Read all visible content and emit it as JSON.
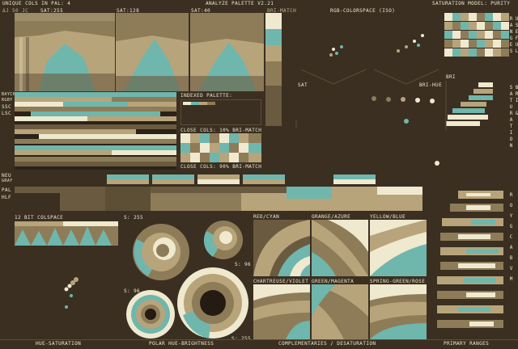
{
  "app": {
    "title": "ANALYZE PALETTE V2.21",
    "header_left": "UNIQUE COLS IN PAL: 4",
    "header_right": "SATURATION MODEL: PURITY",
    "subheader": {
      "bri": "ΔJ 50 JC ",
      "sat1": "SAT:255",
      "sat2": "SAT:128",
      "sat3": "SAT:40",
      "hue_match": "BRI-MATCH",
      "rgb_colorspace": "RGB-COLORSPACE (ISO)"
    }
  },
  "left_labels": [
    "BAYCH",
    "RGBY",
    "SSC",
    "LSC"
  ],
  "mid_labels": [
    "NEU",
    "GRAY",
    "PAL",
    "HLF"
  ],
  "indexed": {
    "title": "INDEXED PALETTE:",
    "close_cols_1": "CLOSE COLS: 10% BRI-MATCH",
    "close_cols_2": "CLOSE COLS: 90% BRI-MATCH"
  },
  "rgb_panel": {
    "sat_label": "SAT",
    "bri_hue_label": "BRI-HUE"
  },
  "right_panel": {
    "bri_label": "BRI",
    "vlabel_top": "USEFUL RANGES",
    "vlabel_mid": "BRI & SATURATION",
    "vlabel_bottom": "ROYGCABVM"
  },
  "colspace": {
    "title": "12 BIT COLSPACE"
  },
  "polar": {
    "s_labels": [
      "S: 255",
      "S: 96",
      "S: 96",
      "S: 255"
    ]
  },
  "complementaries": {
    "labels": [
      "RED/CYAN",
      "ORANGE/AZURE",
      "YELLOW/BLUE",
      "CHARTREUSE/VIOLET",
      "GREEN/MAGENTA",
      "SPRING-GREEN/ROSE"
    ]
  },
  "footer": {
    "hue_sat": "HUE-SATURATION",
    "polar": "POLAR HUE-BRIGHTNESS",
    "compl": "COMPLEMENTARIES / DESATURATION",
    "primary": "PRIMARY RANGES"
  },
  "colors": {
    "cream": "#efe9cf",
    "teal": "#6fb6ad",
    "tan": "#b8a47a",
    "olive": "#8e7c58",
    "dark": "#241c13",
    "bg": "#3a2f21"
  }
}
